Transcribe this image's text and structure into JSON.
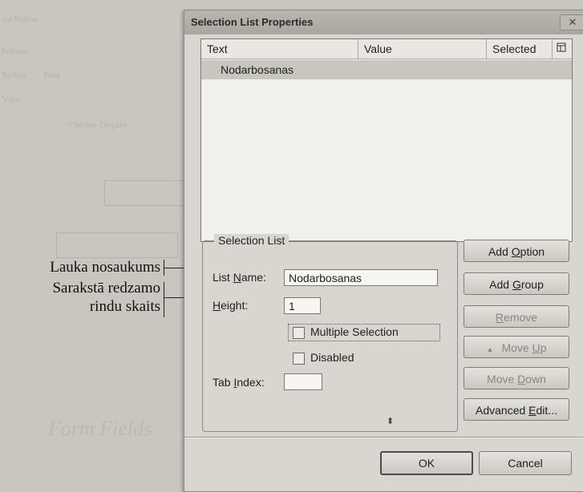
{
  "dialog": {
    "title": "Selection List Properties",
    "close_glyph": "✕"
  },
  "list": {
    "columns": {
      "text": "Text",
      "value": "Value",
      "selected": "Selected",
      "picker_icon": "column-picker-icon"
    },
    "rows": [
      {
        "text": "Nodarbosanas",
        "value": "",
        "selected": false
      }
    ]
  },
  "selection_list": {
    "legend": "Selection List",
    "list_name_label_pre": "List ",
    "list_name_label_key": "N",
    "list_name_label_post": "ame:",
    "list_name_value": "Nodarbosanas",
    "height_label_key": "H",
    "height_label_post": "eight:",
    "height_value": "1",
    "multiple_selection_label": "Multiple Selection",
    "multiple_selection_checked": false,
    "disabled_label": "Disabled",
    "disabled_checked": false,
    "tab_index_label_pre": "Tab ",
    "tab_index_label_key": "I",
    "tab_index_label_post": "ndex:",
    "tab_index_value": ""
  },
  "buttons": {
    "add_option_pre": "Add ",
    "add_option_key": "O",
    "add_option_post": "ption",
    "add_group_pre": "Add ",
    "add_group_key": "G",
    "add_group_post": "roup",
    "remove_key": "R",
    "remove_post": "emove",
    "move_up_pre": "Move ",
    "move_up_key": "U",
    "move_up_post": "p",
    "move_up_arrow": "▲",
    "move_down_pre": "Move ",
    "move_down_key": "D",
    "move_down_post": "own",
    "advanced_edit_pre": "Advanced ",
    "advanced_edit_key": "E",
    "advanced_edit_post": "dit...",
    "ok": "OK",
    "cancel": "Cancel"
  },
  "annotations": {
    "list_name": "Lauka nosaukums",
    "height_line1": "Sarakstā redzamo",
    "height_line2": "rindu skaits"
  },
  "colors": {
    "dialog_bg": "#d9d6cf",
    "list_selected_row": "#c9c6c0"
  }
}
